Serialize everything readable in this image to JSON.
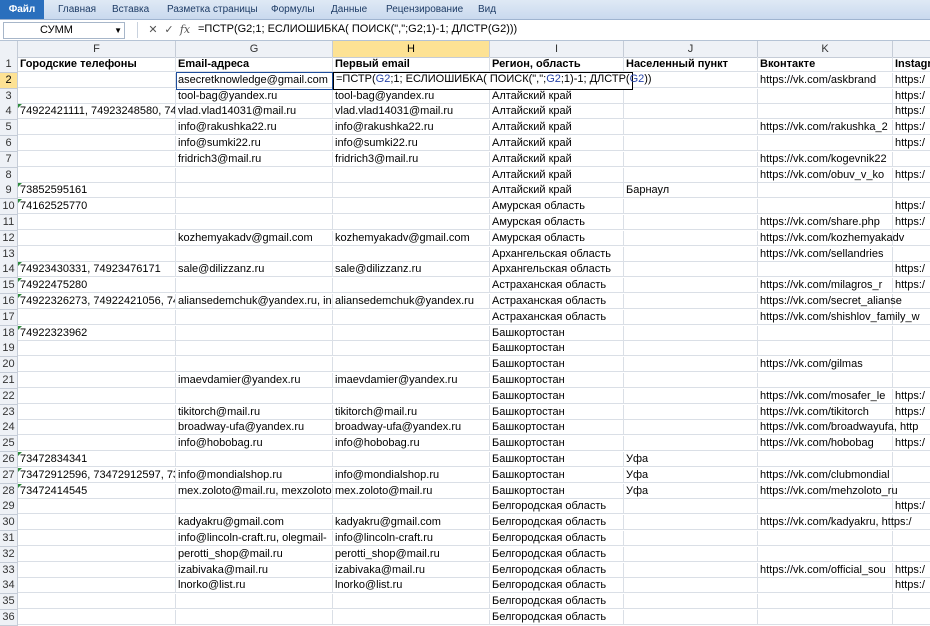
{
  "ribbon": {
    "tabs": [
      "Файл",
      "Главная",
      "Вставка",
      "Разметка страницы",
      "Формулы",
      "Данные",
      "Рецензирование",
      "Вид"
    ]
  },
  "formula_bar": {
    "name_box": "СУММ",
    "cancel_icon": "✕",
    "enter_icon": "✓",
    "fx_label": "fx",
    "formula": "=ПСТР(G2;1; ЕСЛИОШИБКА( ПОИСК(\",\";G2;1)-1; ДЛСТР(G2)))"
  },
  "columns": [
    {
      "letter": "F",
      "selected": false
    },
    {
      "letter": "G",
      "selected": false
    },
    {
      "letter": "H",
      "selected": true
    },
    {
      "letter": "I",
      "selected": false
    },
    {
      "letter": "J",
      "selected": false
    },
    {
      "letter": "K",
      "selected": false
    },
    {
      "letter": "",
      "selected": false
    }
  ],
  "editing_cell": {
    "address": "H2",
    "parts": [
      "=ПСТР(",
      "G2",
      ";1; ЕСЛИОШИБКА( ПОИСК(\",\";",
      "G2",
      ";1)-1; ДЛСТР(",
      "G2",
      "))"
    ]
  },
  "rows": [
    {
      "n": "1",
      "F": "Городские телефоны",
      "G": "Email-адреса",
      "H": "Первый email",
      "I": "Регион, область",
      "J": "Населенный пункт",
      "K": "Вконтакте",
      "L": "Instagr"
    },
    {
      "n": "2",
      "F": "",
      "G": "asecretknowledge@gmail.com",
      "H": "",
      "I": "",
      "J": "",
      "K": "https://vk.com/askbrand",
      "L": "https:/"
    },
    {
      "n": "3",
      "F": "",
      "G": "tool-bag@yandex.ru",
      "H": "tool-bag@yandex.ru",
      "I": "Алтайский край",
      "J": "",
      "K": "",
      "L": "https:/"
    },
    {
      "n": "4",
      "F": "74922421111, 74923248580, 7492",
      "G": "vlad.vlad14031@mail.ru",
      "H": "vlad.vlad14031@mail.ru",
      "I": "Алтайский край",
      "J": "",
      "K": "",
      "L": "https:/"
    },
    {
      "n": "5",
      "F": "",
      "G": "info@rakushka22.ru",
      "H": "info@rakushka22.ru",
      "I": "Алтайский край",
      "J": "",
      "K": "https://vk.com/rakushka_2",
      "L": "https:/"
    },
    {
      "n": "6",
      "F": "",
      "G": "info@sumki22.ru",
      "H": "info@sumki22.ru",
      "I": "Алтайский край",
      "J": "",
      "K": "",
      "L": "https:/"
    },
    {
      "n": "7",
      "F": "",
      "G": "fridrich3@mail.ru",
      "H": "fridrich3@mail.ru",
      "I": "Алтайский край",
      "J": "",
      "K": "https://vk.com/kogevnik22",
      "L": ""
    },
    {
      "n": "8",
      "F": "",
      "G": "",
      "H": "",
      "I": "Алтайский край",
      "J": "",
      "K": "https://vk.com/obuv_v_ko",
      "L": "https:/"
    },
    {
      "n": "9",
      "F": "73852595161",
      "G": "",
      "H": "",
      "I": "Алтайский край",
      "J": "Барнаул",
      "K": "",
      "L": ""
    },
    {
      "n": "10",
      "F": "74162525770",
      "G": "",
      "H": "",
      "I": "Амурская область",
      "J": "",
      "K": "",
      "L": "https:/"
    },
    {
      "n": "11",
      "F": "",
      "G": "",
      "H": "",
      "I": "Амурская область",
      "J": "",
      "K": "https://vk.com/share.php",
      "L": "https:/"
    },
    {
      "n": "12",
      "F": "",
      "G": "kozhemyakadv@gmail.com",
      "H": "kozhemyakadv@gmail.com",
      "I": "Амурская область",
      "J": "",
      "K": "https://vk.com/kozhemyakadv",
      "L": ""
    },
    {
      "n": "13",
      "F": "",
      "G": "",
      "H": "",
      "I": "Архангельская область",
      "J": "",
      "K": "https://vk.com/sellandries",
      "L": ""
    },
    {
      "n": "14",
      "F": "74923430331, 74923476171",
      "G": "sale@dilizzanz.ru",
      "H": "sale@dilizzanz.ru",
      "I": "Архангельская область",
      "J": "",
      "K": "",
      "L": "https:/"
    },
    {
      "n": "15",
      "F": "74922475280",
      "G": "",
      "H": "",
      "I": "Астраханская область",
      "J": "",
      "K": "https://vk.com/milagros_r",
      "L": "https:/"
    },
    {
      "n": "16",
      "F": "74922326273, 74922421056, 7492",
      "G": "aliansedemchuk@yandex.ru, in",
      "H": "aliansedemchuk@yandex.ru",
      "I": "Астраханская область",
      "J": "",
      "K": "https://vk.com/secret_aliansе",
      "L": ""
    },
    {
      "n": "17",
      "F": "",
      "G": "",
      "H": "",
      "I": "Астраханская область",
      "J": "",
      "K": "https://vk.com/shishlov_family_w",
      "L": ""
    },
    {
      "n": "18",
      "F": "74922323962",
      "G": "",
      "H": "",
      "I": "Башкортостан",
      "J": "",
      "K": "",
      "L": ""
    },
    {
      "n": "19",
      "F": "",
      "G": "",
      "H": "",
      "I": "Башкортостан",
      "J": "",
      "K": "",
      "L": ""
    },
    {
      "n": "20",
      "F": "",
      "G": "",
      "H": "",
      "I": "Башкортостан",
      "J": "",
      "K": "https://vk.com/gilmas",
      "L": ""
    },
    {
      "n": "21",
      "F": "",
      "G": "imaevdamier@yandex.ru",
      "H": "imaevdamier@yandex.ru",
      "I": "Башкортостан",
      "J": "",
      "K": "",
      "L": ""
    },
    {
      "n": "22",
      "F": "",
      "G": "",
      "H": "",
      "I": "Башкортостан",
      "J": "",
      "K": "https://vk.com/mosafer_le",
      "L": "https:/"
    },
    {
      "n": "23",
      "F": "",
      "G": "tikitorch@mail.ru",
      "H": "tikitorch@mail.ru",
      "I": "Башкортостан",
      "J": "",
      "K": "https://vk.com/tikitorch",
      "L": "https:/"
    },
    {
      "n": "24",
      "F": "",
      "G": "broadway-ufa@yandex.ru",
      "H": "broadway-ufa@yandex.ru",
      "I": "Башкортостан",
      "J": "",
      "K": "https://vk.com/broadwayufa, http",
      "L": ""
    },
    {
      "n": "25",
      "F": "",
      "G": "info@hobobag.ru",
      "H": "info@hobobag.ru",
      "I": "Башкортостан",
      "J": "",
      "K": "https://vk.com/hobobag",
      "L": "https:/"
    },
    {
      "n": "26",
      "F": "73472834341",
      "G": "",
      "H": "",
      "I": "Башкортостан",
      "J": "Уфа",
      "K": "",
      "L": ""
    },
    {
      "n": "27",
      "F": "73472912596, 73472912597, 7351",
      "G": "info@mondialshop.ru",
      "H": "info@mondialshop.ru",
      "I": "Башкортостан",
      "J": "Уфа",
      "K": "https://vk.com/clubmondial",
      "L": ""
    },
    {
      "n": "28",
      "F": "73472414545",
      "G": "mex.zoloto@mail.ru, mexzoloto",
      "H": "mex.zoloto@mail.ru",
      "I": "Башкортостан",
      "J": "Уфа",
      "K": "https://vk.com/mehzoloto_ru",
      "L": ""
    },
    {
      "n": "29",
      "F": "",
      "G": "",
      "H": "",
      "I": "Белгородская область",
      "J": "",
      "K": "",
      "L": "https:/"
    },
    {
      "n": "30",
      "F": "",
      "G": "kadyakru@gmail.com",
      "H": "kadyakru@gmail.com",
      "I": "Белгородская область",
      "J": "",
      "K": "https://vk.com/kadyakru, https:/",
      "L": ""
    },
    {
      "n": "31",
      "F": "",
      "G": "info@lincoln-craft.ru, olegmail-",
      "H": "info@lincoln-craft.ru",
      "I": "Белгородская область",
      "J": "",
      "K": "",
      "L": ""
    },
    {
      "n": "32",
      "F": "",
      "G": "perotti_shop@mail.ru",
      "H": "perotti_shop@mail.ru",
      "I": "Белгородская область",
      "J": "",
      "K": "",
      "L": ""
    },
    {
      "n": "33",
      "F": "",
      "G": "izabivaka@mail.ru",
      "H": "izabivaka@mail.ru",
      "I": "Белгородская область",
      "J": "",
      "K": "https://vk.com/official_sou",
      "L": "https:/"
    },
    {
      "n": "34",
      "F": "",
      "G": "lnorko@list.ru",
      "H": "lnorko@list.ru",
      "I": "Белгородская область",
      "J": "",
      "K": "",
      "L": "https:/"
    },
    {
      "n": "35",
      "F": "",
      "G": "",
      "H": "",
      "I": "Белгородская область",
      "J": "",
      "K": "",
      "L": ""
    },
    {
      "n": "36",
      "F": "",
      "G": "",
      "H": "",
      "I": "Белгородская область",
      "J": "",
      "K": "",
      "L": ""
    }
  ],
  "green_triangle_rows": [
    "4",
    "9",
    "10",
    "14",
    "15",
    "16",
    "18",
    "26",
    "27",
    "28"
  ]
}
